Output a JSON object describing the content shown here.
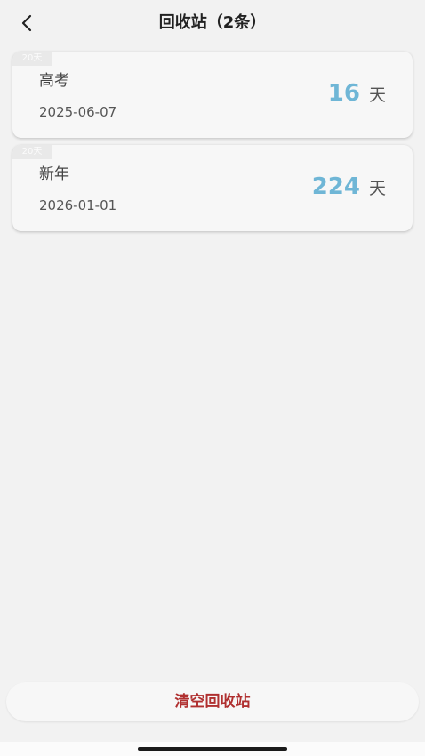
{
  "header": {
    "title": "回收站（2条）"
  },
  "items": [
    {
      "tag": "20天",
      "name": "高考",
      "date": "2025-06-07",
      "count": "16",
      "unit": "天"
    },
    {
      "tag": "20天",
      "name": "新年",
      "date": "2026-01-01",
      "count": "224",
      "unit": "天"
    }
  ],
  "footer": {
    "clear_label": "清空回收站"
  },
  "colors": {
    "accent": "#6fb6d6",
    "danger": "#b03030",
    "background": "#f2f2f2"
  }
}
